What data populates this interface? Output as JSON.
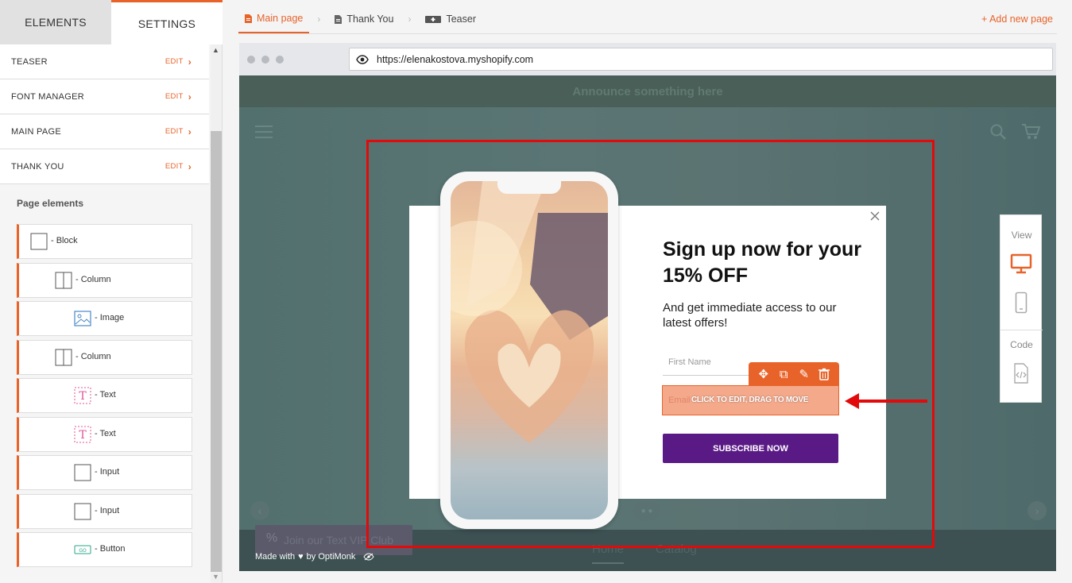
{
  "left_panel": {
    "tabs": {
      "elements": "ELEMENTS",
      "settings": "SETTINGS"
    },
    "nav_items": [
      {
        "label": "TEASER",
        "action": "EDIT"
      },
      {
        "label": "FONT MANAGER",
        "action": "EDIT"
      },
      {
        "label": "MAIN PAGE",
        "action": "EDIT"
      },
      {
        "label": "THANK YOU",
        "action": "EDIT"
      }
    ],
    "page_elements_title": "Page elements",
    "page_elements": [
      {
        "label": "- Block",
        "icon": "block-icon"
      },
      {
        "label": "- Column",
        "icon": "column-icon"
      },
      {
        "label": "- Image",
        "icon": "image-icon"
      },
      {
        "label": "- Column",
        "icon": "column-icon"
      },
      {
        "label": "- Text",
        "icon": "text-icon"
      },
      {
        "label": "- Text",
        "icon": "text-icon"
      },
      {
        "label": "- Input",
        "icon": "input-icon"
      },
      {
        "label": "- Input",
        "icon": "input-icon"
      },
      {
        "label": "- Button",
        "icon": "button-icon"
      }
    ]
  },
  "breadcrumbs": {
    "items": [
      {
        "label": "Main page",
        "icon": "document-icon"
      },
      {
        "label": "Thank You",
        "icon": "document-icon"
      },
      {
        "label": "Teaser",
        "icon": "teaser-icon"
      }
    ],
    "add_page": "+ Add new page"
  },
  "browser": {
    "url": "https://elenakostova.myshopify.com"
  },
  "site": {
    "announcement": "Announce something here",
    "vip_button": "Join our Text VIP Club",
    "nav_home": "Home",
    "nav_catalog": "Catalog",
    "made_with": "Made with",
    "made_by": "by OptiMonk"
  },
  "popup": {
    "headline": "Sign up now for your 15% OFF",
    "subline": "And get immediate access to our latest offers!",
    "first_name_placeholder": "First Name",
    "email_placeholder": "Email",
    "edit_hint": "CLICK TO EDIT, DRAG TO MOVE",
    "subscribe_label": "SUBSCRIBE NOW"
  },
  "view_panel": {
    "view_label": "View",
    "code_label": "Code"
  },
  "colors": {
    "accent": "#e8632a",
    "subscribe": "#5a1a86",
    "highlight": "#e20a0a"
  }
}
